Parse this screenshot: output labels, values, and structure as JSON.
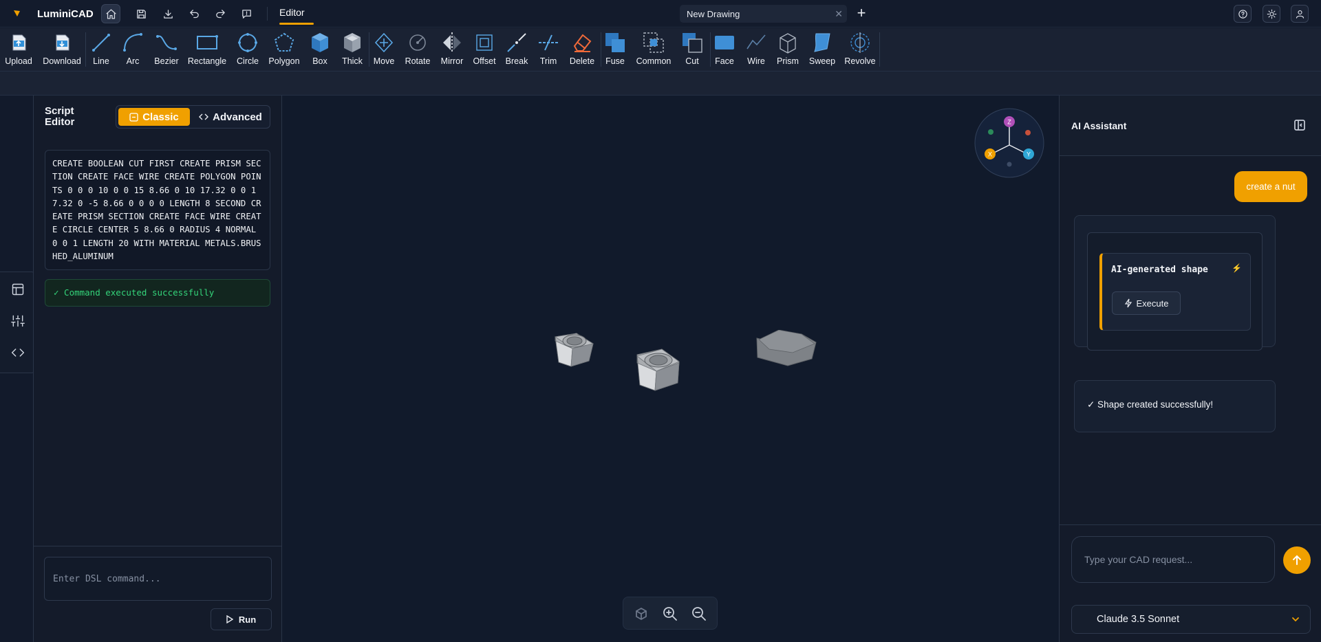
{
  "app": {
    "name": "LuminiCAD",
    "brand_color": "#f0a000"
  },
  "header": {
    "editor_tab": "Editor",
    "drawing_tab": {
      "name": "New Drawing",
      "close": "✕"
    },
    "new_tab": "+"
  },
  "toolbar": {
    "tools": [
      {
        "label": "Upload",
        "icon": "upload-icon"
      },
      {
        "label": "Download",
        "icon": "download-icon"
      },
      {
        "label": "Line",
        "icon": "line-icon"
      },
      {
        "label": "Arc",
        "icon": "arc-icon"
      },
      {
        "label": "Bezier",
        "icon": "bezier-icon"
      },
      {
        "label": "Rectangle",
        "icon": "rectangle-icon"
      },
      {
        "label": "Circle",
        "icon": "circle-icon"
      },
      {
        "label": "Polygon",
        "icon": "polygon-icon"
      },
      {
        "label": "Box",
        "icon": "box-icon"
      },
      {
        "label": "Thick",
        "icon": "thick-icon"
      },
      {
        "label": "Move",
        "icon": "move-icon"
      },
      {
        "label": "Rotate",
        "icon": "rotate-icon"
      },
      {
        "label": "Mirror",
        "icon": "mirror-icon"
      },
      {
        "label": "Offset",
        "icon": "offset-icon"
      },
      {
        "label": "Break",
        "icon": "break-icon"
      },
      {
        "label": "Trim",
        "icon": "trim-icon"
      },
      {
        "label": "Delete",
        "icon": "eraser-icon"
      },
      {
        "label": "Fuse",
        "icon": "fuse-icon"
      },
      {
        "label": "Common",
        "icon": "common-icon"
      },
      {
        "label": "Cut",
        "icon": "cut-icon"
      },
      {
        "label": "Face",
        "icon": "face-icon"
      },
      {
        "label": "Wire",
        "icon": "wire-icon"
      },
      {
        "label": "Prism",
        "icon": "prism-icon"
      },
      {
        "label": "Sweep",
        "icon": "sweep-icon"
      },
      {
        "label": "Revolve",
        "icon": "revolve-icon"
      }
    ]
  },
  "script_editor": {
    "title": "Script Editor",
    "mode_classic": "Classic",
    "mode_advanced": "Advanced",
    "script": "CREATE BOOLEAN CUT FIRST CREATE PRISM SECTION CREATE FACE WIRE CREATE POLYGON POINTS 0 0 0 10 0 0 15 8.66 0 10 17.32 0 0 17.32 0 -5 8.66 0 0 0 0 LENGTH 8 SECOND CREATE PRISM SECTION CREATE FACE WIRE CREATE CIRCLE CENTER 5 8.66 0 RADIUS 4 NORMAL 0 0 1 LENGTH 20 WITH MATERIAL METALS.BRUSHED_ALUMINUM",
    "status": "✓ Command executed successfully",
    "input_placeholder": "Enter DSL command...",
    "run_label": "Run"
  },
  "viewport": {
    "axes": {
      "z": "Z",
      "x": "X",
      "y": "Y",
      "z_color": "#b04fb8",
      "x_color": "#f0a000",
      "y_color": "#2fa7d6"
    }
  },
  "ai_assistant": {
    "title": "AI Assistant",
    "user_message": "create a nut",
    "card_title": "AI-generated shape",
    "execute_label": "Execute",
    "success_message": "✓ Shape created successfully!",
    "input_placeholder": "Type your CAD request...",
    "model": "Claude 3.5 Sonnet"
  }
}
